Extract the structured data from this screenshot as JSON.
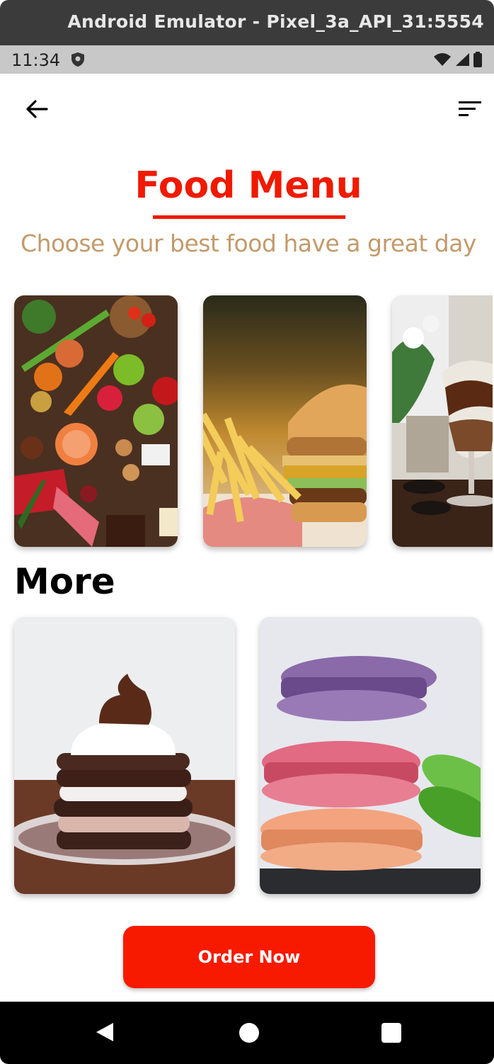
{
  "window": {
    "title": "Android Emulator - Pixel_3a_API_31:5554"
  },
  "status_bar": {
    "time": "11:34",
    "icons": [
      "shield-icon",
      "wifi-icon",
      "signal-icon",
      "battery-icon"
    ]
  },
  "header": {
    "back_icon": "arrow-left-icon",
    "filter_icon": "sort-lines-icon"
  },
  "main": {
    "title": "Food Menu",
    "subtitle": "Choose your best food have a great day",
    "featured_cards": [
      {
        "image": "vegetables-and-groceries-image"
      },
      {
        "image": "burger-and-fries-image"
      },
      {
        "image": "chocolate-dessert-glass-image"
      }
    ],
    "more_title": "More",
    "more_cards": [
      {
        "image": "layered-cookie-dessert-image"
      },
      {
        "image": "macarons-stack-image"
      }
    ],
    "order_button_label": "Order Now"
  },
  "colors": {
    "accent": "#f01a00",
    "subtitle": "#c49a6a",
    "button": "#f81a00"
  },
  "nav_bar": {
    "icons": [
      "back-triangle-icon",
      "home-circle-icon",
      "recents-square-icon"
    ]
  }
}
